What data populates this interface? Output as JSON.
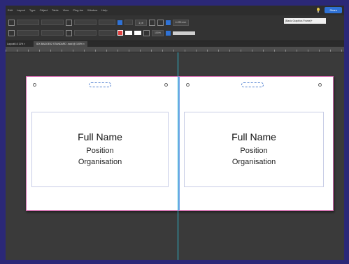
{
  "menu": {
    "items": [
      "Edit",
      "Layout",
      "Type",
      "Object",
      "Table",
      "View",
      "Plug-Ins",
      "Window",
      "Help"
    ],
    "share_label": "Share"
  },
  "control": {
    "stroke_weight": "1 pt",
    "num_value": "4.233 mm",
    "style_field": "[Basic Graphics Frame]+",
    "percent_value": "100%"
  },
  "doc": {
    "tab_left": "Layout0-6 11% ×",
    "tab_active": "IDX BADGE02 STANDARD .indd @ 100% ×"
  },
  "badges": [
    {
      "name": "Full Name",
      "position": "Position",
      "org": "Organisation"
    },
    {
      "name": "Full Name",
      "position": "Position",
      "org": "Organisation"
    }
  ],
  "colors": {
    "accent": "#2f72d6",
    "guide": "#2bbcd4",
    "page_border": "#d56bb0"
  }
}
